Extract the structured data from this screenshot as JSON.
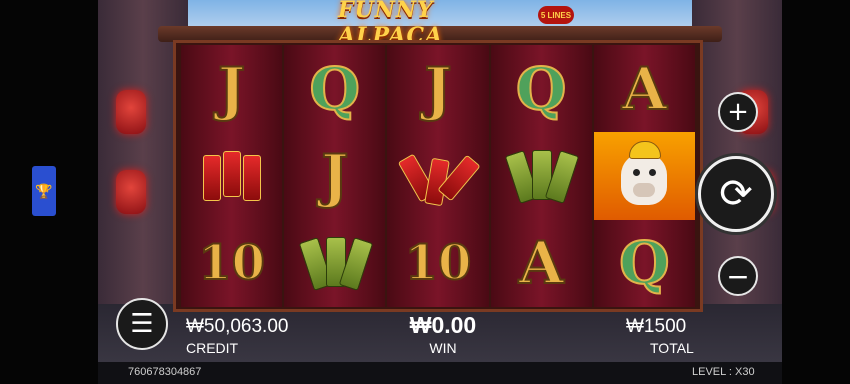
{
  "game": {
    "title": "FUNNY ALPACA",
    "lines_badge": "5 LINES"
  },
  "reels": [
    [
      "J",
      "firecrackers",
      "10"
    ],
    [
      "Q",
      "J",
      "fans"
    ],
    [
      "J",
      "firecracker-bundle",
      "10"
    ],
    [
      "Q",
      "fans",
      "A"
    ],
    [
      "A",
      "alpaca",
      "Q"
    ]
  ],
  "symbols": {
    "J": "J",
    "Q": "Q",
    "A": "A",
    "10": "10"
  },
  "hud": {
    "credit_value": "₩50,063.00",
    "credit_label": "CREDIT",
    "win_value": "₩0.00",
    "win_label": "WIN",
    "total_value": "₩1500",
    "total_label": "TOTAL",
    "round_id": "760678304867",
    "level": "LEVEL : X30"
  },
  "controls": {
    "plus_icon": "+",
    "minus_icon": "−",
    "spin_icon": "⟳",
    "menu_icon": "☰"
  },
  "side": {
    "trophy_icon": "🏆"
  },
  "colors": {
    "reel_bg": "#7a1428",
    "gold": "#e9b348",
    "green": "#4fa15b",
    "side_tab": "#2a4fd0"
  }
}
